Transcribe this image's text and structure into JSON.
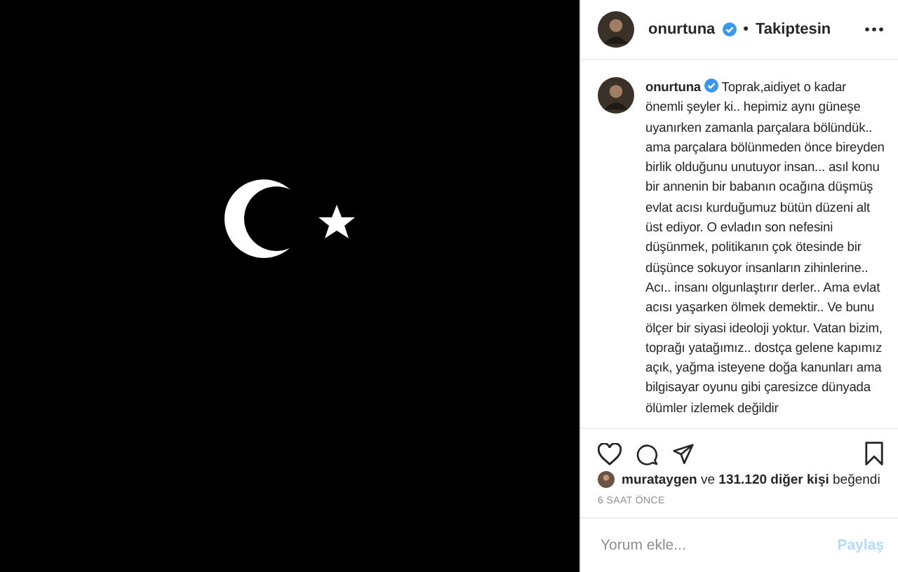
{
  "header": {
    "username": "onurtuna",
    "separator": "•",
    "follow_status": "Takiptesin"
  },
  "caption": {
    "username": "onurtuna",
    "text": "Toprak,aidiyet o kadar önemli şeyler ki.. hepimiz aynı güneşe uyanırken zamanla parçalara bölündük.. ama parçalara bölünmeden önce bireyden birlik olduğunu unutuyor insan... asıl konu bir annenin bir babanın ocağına düşmüş evlat acısı kurduğumuz bütün düzeni alt üst ediyor. O evladın son nefesini düşünmek, politikanın çok ötesinde bir düşünce sokuyor insanların zihinlerine.. Acı.. insanı olgunlaştırır derler.. Ama evlat acısı yaşarken ölmek demektir.. Ve bunu ölçer bir siyasi ideoloji yoktur. Vatan bizim, toprağı yatağımız.. dostça gelene kapımız açık, yağma isteyene doğa kanunları ama bilgisayar oyunu gibi çaresizce dünyada ölümler izlemek değildir"
  },
  "actions": {
    "liked": false,
    "saved": false
  },
  "likes": "**murataygen** ve **131.120 diğer kişi** beğendi",
  "time": "6 SAAT ÖNCE",
  "comment": {
    "placeholder": "Yorum ekle...",
    "button": "Paylaş",
    "disabled": true
  }
}
